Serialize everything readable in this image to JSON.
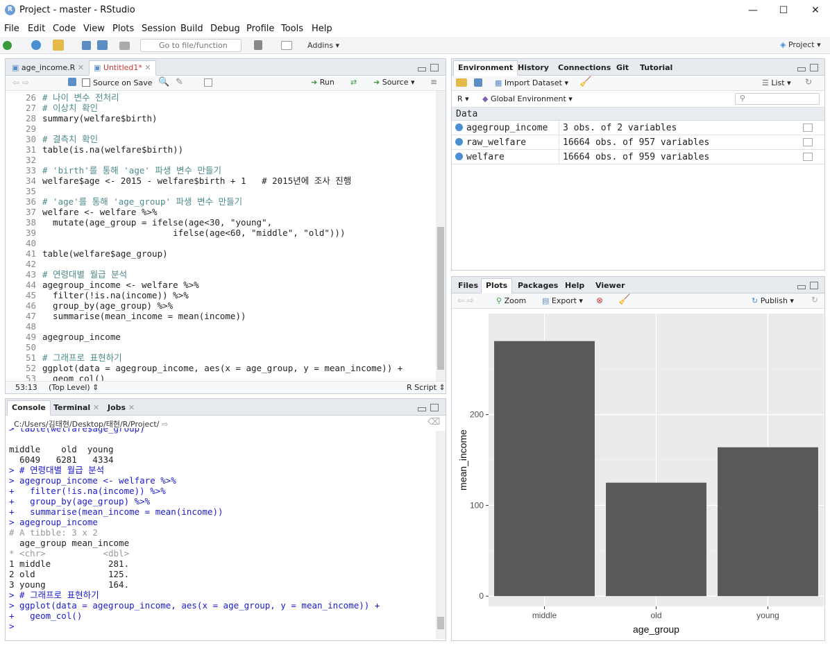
{
  "window": {
    "title": "Project - master - RStudio",
    "app_icon": "R"
  },
  "menu": [
    "File",
    "Edit",
    "Code",
    "View",
    "Plots",
    "Session",
    "Build",
    "Debug",
    "Profile",
    "Tools",
    "Help"
  ],
  "toolbar": {
    "goto_placeholder": "Go to file/function",
    "addins": "Addins",
    "project": "Project"
  },
  "editor": {
    "tabs": [
      {
        "label": "age_income.R",
        "active": false
      },
      {
        "label": "Untitled1*",
        "active": true
      }
    ],
    "source_on_save": "Source on Save",
    "run": "Run",
    "source": "Source",
    "lines": [
      {
        "n": "26",
        "t": "# 나이 변수 전처리",
        "c": "cmt"
      },
      {
        "n": "27",
        "t": "# 이상치 확인",
        "c": "cmt"
      },
      {
        "n": "28",
        "t": "summary(welfare$birth)",
        "c": ""
      },
      {
        "n": "29",
        "t": "",
        "c": ""
      },
      {
        "n": "30",
        "t": "# 결측치 확인",
        "c": "cmt"
      },
      {
        "n": "31",
        "t": "table(is.na(welfare$birth))",
        "c": ""
      },
      {
        "n": "32",
        "t": "",
        "c": ""
      },
      {
        "n": "33",
        "t": "# 'birth'를 통해 'age' 파생 변수 만들기",
        "c": "cmt"
      },
      {
        "n": "34",
        "t": "welfare$age <- 2015 - welfare$birth + 1   # 2015년에 조사 진행",
        "c": "mix34"
      },
      {
        "n": "35",
        "t": "",
        "c": ""
      },
      {
        "n": "36",
        "t": "# 'age'를 통해 'age_group' 파생 변수 만들기",
        "c": "cmt"
      },
      {
        "n": "37",
        "t": "welfare <- welfare %>%",
        "c": ""
      },
      {
        "n": "38",
        "t": "  mutate(age_group = ifelse(age<30, \"young\",",
        "c": ""
      },
      {
        "n": "39",
        "t": "                         ifelse(age<60, \"middle\", \"old\")))",
        "c": ""
      },
      {
        "n": "40",
        "t": "",
        "c": ""
      },
      {
        "n": "41",
        "t": "table(welfare$age_group)",
        "c": ""
      },
      {
        "n": "42",
        "t": "",
        "c": ""
      },
      {
        "n": "43",
        "t": "# 연령대별 월급 분석",
        "c": "cmt"
      },
      {
        "n": "44",
        "t": "agegroup_income <- welfare %>%",
        "c": ""
      },
      {
        "n": "45",
        "t": "  filter(!is.na(income)) %>%",
        "c": ""
      },
      {
        "n": "46",
        "t": "  group_by(age_group) %>%",
        "c": ""
      },
      {
        "n": "47",
        "t": "  summarise(mean_income = mean(income))",
        "c": ""
      },
      {
        "n": "48",
        "t": "",
        "c": ""
      },
      {
        "n": "49",
        "t": "agegroup_income",
        "c": ""
      },
      {
        "n": "50",
        "t": "",
        "c": ""
      },
      {
        "n": "51",
        "t": "# 그래프로 표현하기",
        "c": "cmt"
      },
      {
        "n": "52",
        "t": "ggplot(data = agegroup_income, aes(x = age_group, y = mean_income)) +",
        "c": ""
      },
      {
        "n": "53",
        "t": "  geom_col()",
        "c": ""
      }
    ],
    "status": {
      "pos": "53:13",
      "scope": "(Top Level)",
      "type": "R Script"
    }
  },
  "console": {
    "tabs": [
      "Console",
      "Terminal",
      "Jobs"
    ],
    "path": "C:/Users/김태현/Desktop/태현/R/Project/",
    "lines": [
      {
        "t": "> table(welfare$age_group)",
        "c": "in"
      },
      {
        "t": "",
        "c": ""
      },
      {
        "t": "middle    old  young ",
        "c": ""
      },
      {
        "t": "  6049   6281   4334 ",
        "c": ""
      },
      {
        "t": "> # 연령대별 월급 분석",
        "c": "in"
      },
      {
        "t": "> agegroup_income <- welfare %>%",
        "c": "in"
      },
      {
        "t": "+   filter(!is.na(income)) %>%",
        "c": "in"
      },
      {
        "t": "+   group_by(age_group) %>%",
        "c": "in"
      },
      {
        "t": "+   summarise(mean_income = mean(income))",
        "c": "in"
      },
      {
        "t": "> agegroup_income",
        "c": "in"
      },
      {
        "t": "# A tibble: 3 x 2",
        "c": "dim"
      },
      {
        "t": "  age_group mean_income",
        "c": ""
      },
      {
        "t": "* <chr>           <dbl>",
        "c": "dim"
      },
      {
        "t": "1 middle           281.",
        "c": ""
      },
      {
        "t": "2 old              125.",
        "c": ""
      },
      {
        "t": "3 young            164.",
        "c": ""
      },
      {
        "t": "> # 그래프로 표현하기",
        "c": "in"
      },
      {
        "t": "> ggplot(data = agegroup_income, aes(x = age_group, y = mean_income)) +",
        "c": "in"
      },
      {
        "t": "+   geom_col()",
        "c": "in"
      },
      {
        "t": "> ",
        "c": "in"
      }
    ]
  },
  "environment": {
    "tabs": [
      "Environment",
      "History",
      "Connections",
      "Git",
      "Tutorial"
    ],
    "import_dataset": "Import Dataset",
    "list": "List",
    "lang": "R",
    "scope": "Global Environment",
    "section": "Data",
    "rows": [
      {
        "name": "agegroup_income",
        "value": "3 obs. of 2 variables"
      },
      {
        "name": "raw_welfare",
        "value": "16664 obs. of 957 variables"
      },
      {
        "name": "welfare",
        "value": "16664 obs. of 959 variables"
      }
    ]
  },
  "files": {
    "tabs": [
      "Files",
      "Plots",
      "Packages",
      "Help",
      "Viewer"
    ],
    "zoom": "Zoom",
    "export": "Export",
    "publish": "Publish"
  },
  "chart_data": {
    "type": "bar",
    "categories": [
      "middle",
      "old",
      "young"
    ],
    "values": [
      281,
      125,
      164
    ],
    "xlabel": "age_group",
    "ylabel": "mean_income",
    "ylim": [
      0,
      300
    ],
    "yticks": [
      0,
      100,
      200
    ],
    "bar_color": "#595959",
    "panel_bg": "#ebebeb"
  }
}
